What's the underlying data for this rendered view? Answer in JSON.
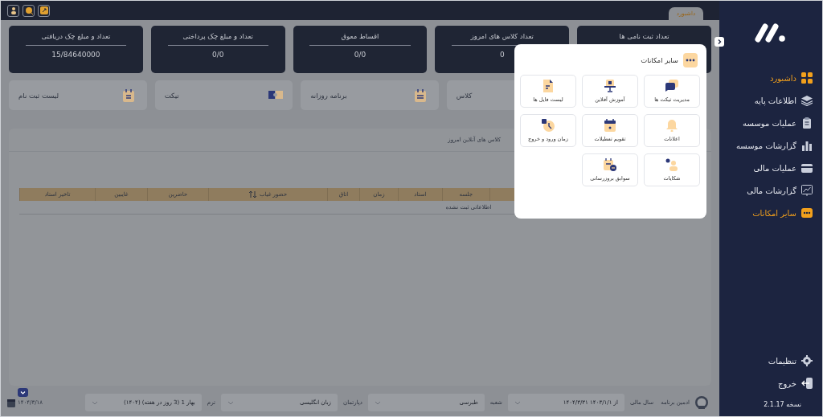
{
  "top_bar": {
    "tabs": [
      {
        "label": "داشبورد",
        "selected": true
      }
    ]
  },
  "stat_cards": [
    {
      "title": "تعداد ثبت نامی ها"
    },
    {
      "title": "تعداد کلاس های امروز",
      "value": "0"
    },
    {
      "title": "اقساط معوق",
      "value": "0/0"
    },
    {
      "title": "تعداد و مبلغ چک پرداختی",
      "value": "0/0"
    },
    {
      "title": "تعداد و مبلغ چک دریافتی",
      "value": "15/84640000"
    }
  ],
  "quick_cards": [
    {
      "label": "کلاس"
    },
    {
      "label": "برنامه روزانه"
    },
    {
      "label": "تیکت"
    },
    {
      "label": "لیست ثبت نام"
    }
  ],
  "panel": {
    "tabs": [
      {
        "label": "کلاس های آنلاین امروز"
      }
    ],
    "table": {
      "columns": [
        {
          "label": "جلسه",
          "sortable": false
        },
        {
          "label": "استاد",
          "sortable": false
        },
        {
          "label": "زمان",
          "sortable": false
        },
        {
          "label": "اتاق",
          "sortable": false
        },
        {
          "label": "حضور غیاب",
          "sortable": true
        },
        {
          "label": "حاضرین",
          "sortable": false
        },
        {
          "label": "غایبین",
          "sortable": false
        },
        {
          "label": "تاخیر استاد",
          "sortable": false
        }
      ],
      "empty_message": "اطلاعاتی ثبت نشده"
    }
  },
  "status_bar": {
    "user": "ادمین برنامه",
    "fields": [
      {
        "label": "سال مالی",
        "value": "از ۱۴۰۳/۱/۱ ۱۴۰۴/۳/۳۱"
      },
      {
        "label": "شعبه",
        "value": "طبرسی"
      },
      {
        "label": "دپارتمان",
        "value": "زبان انگلیسی"
      },
      {
        "label": "ترم",
        "value": "بهار 1 (3 روز در هفته) (۱۴۰۴)"
      }
    ],
    "date": "۱۴۰۴/۳/۱۸"
  },
  "sidebar": {
    "items": [
      {
        "label": "داشبورد",
        "selected": true
      },
      {
        "label": "اطلاعات پایه",
        "selected": false
      },
      {
        "label": "عملیات موسسه",
        "selected": false
      },
      {
        "label": "گزارشات موسسه",
        "selected": false
      },
      {
        "label": "عملیات مالی",
        "selected": false
      },
      {
        "label": "گزارشات مالی",
        "selected": false
      },
      {
        "label": "سایر امکانات",
        "selected": true
      }
    ],
    "bottom_items": [
      {
        "label": "تنظیمات"
      },
      {
        "label": "خروج"
      }
    ],
    "version": "نسخه 2.1.17"
  },
  "popup": {
    "title": "سایر امکانات",
    "items": [
      {
        "label": "مدیریت تیکت ها"
      },
      {
        "label": "آموزش آفلاین"
      },
      {
        "label": "لیست فایل ها"
      },
      {
        "label": "اعلانات"
      },
      {
        "label": "تقویم تعطیلات"
      },
      {
        "label": "زمان ورود و خروج"
      },
      {
        "label": "شکایات"
      },
      {
        "label": "سوابق بروزرسانی"
      }
    ]
  }
}
